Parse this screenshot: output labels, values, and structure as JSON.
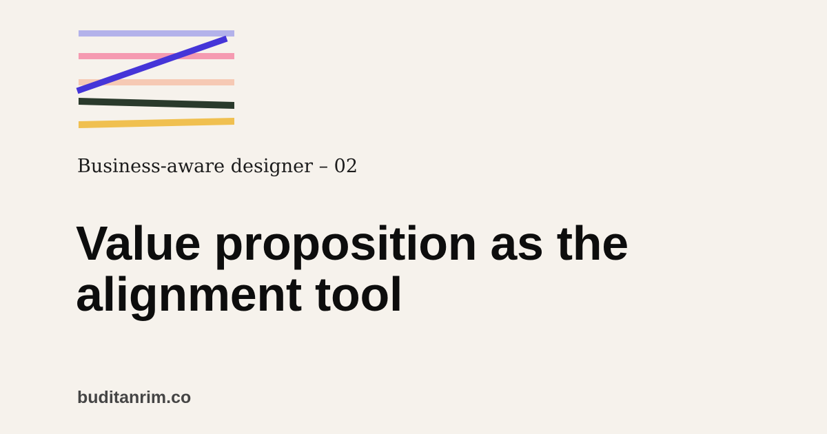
{
  "series_label": "Business-aware designer – 02",
  "title": "Value proposition as the alignment tool",
  "site": "buditanrim.co",
  "colors": {
    "background": "#F6F2EC",
    "lavender_line": "#B3B2EA",
    "pink_line": "#F59AB1",
    "peach_line": "#F6C9B4",
    "dark_green_line": "#2A3A2C",
    "yellow_line": "#F0C050",
    "blue_diagonal": "#4535D8"
  }
}
